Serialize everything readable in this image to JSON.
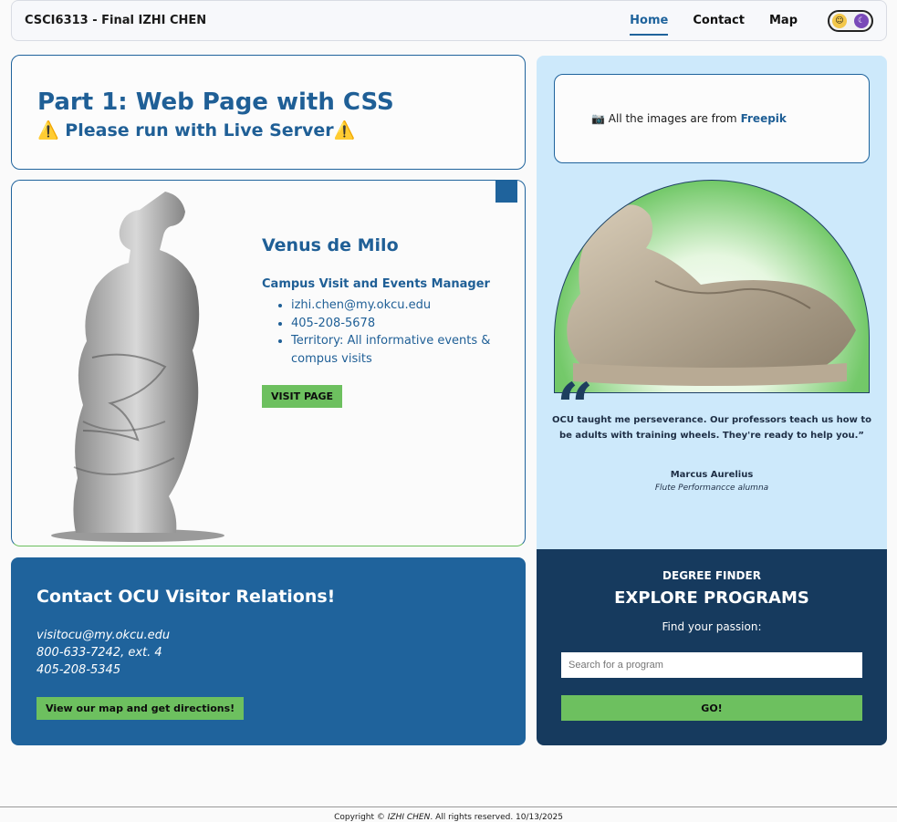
{
  "nav": {
    "brand": "CSCI6313 - Final IZHI CHEN",
    "links": [
      "Home",
      "Contact",
      "Map"
    ],
    "toggle_icons": [
      "sun-icon",
      "moon-icon"
    ]
  },
  "intro": {
    "title": "Part 1: Web Page with CSS",
    "subtitle": "Please run with Live Server",
    "warning_icon": "⚠️"
  },
  "profile": {
    "name": "Venus de Milo",
    "role": "Campus Visit and Events Manager",
    "email": "izhi.chen@my.okcu.edu",
    "phone": "405-208-5678",
    "territory": "Territory: All informative events & compus visits",
    "button": "VISIT PAGE"
  },
  "contact": {
    "title": "Contact OCU Visitor Relations!",
    "email": "visitocu@my.okcu.edu",
    "phone1": "800-633-7242, ext. 4",
    "phone2": "405-208-5345",
    "button": "View our map and get directions!"
  },
  "credit": {
    "icon": "📷",
    "text": "All the images are from",
    "link": "Freepik"
  },
  "testimonial": {
    "quote": "OCU taught me perseverance. Our professors teach us how to be adults with training wheels. They're ready to help you.",
    "closing": "”",
    "author": "Marcus Aurelius",
    "role": "Flute Performancce alumna"
  },
  "finder": {
    "eyebrow": "DEGREE FINDER",
    "headline": "EXPLORE PROGRAMS",
    "tagline": "Find your passion:",
    "placeholder": "Search for a program",
    "button": "GO!"
  },
  "footer": {
    "prefix": "Copyright ©",
    "name": "IZHI CHEN",
    "suffix": ". All rights reserved. 10/13/2025"
  },
  "colors": {
    "primary": "#1f639c",
    "accent_green": "#6dc05f",
    "dark_navy": "#163a5e",
    "light_blue": "#cde9fb"
  }
}
